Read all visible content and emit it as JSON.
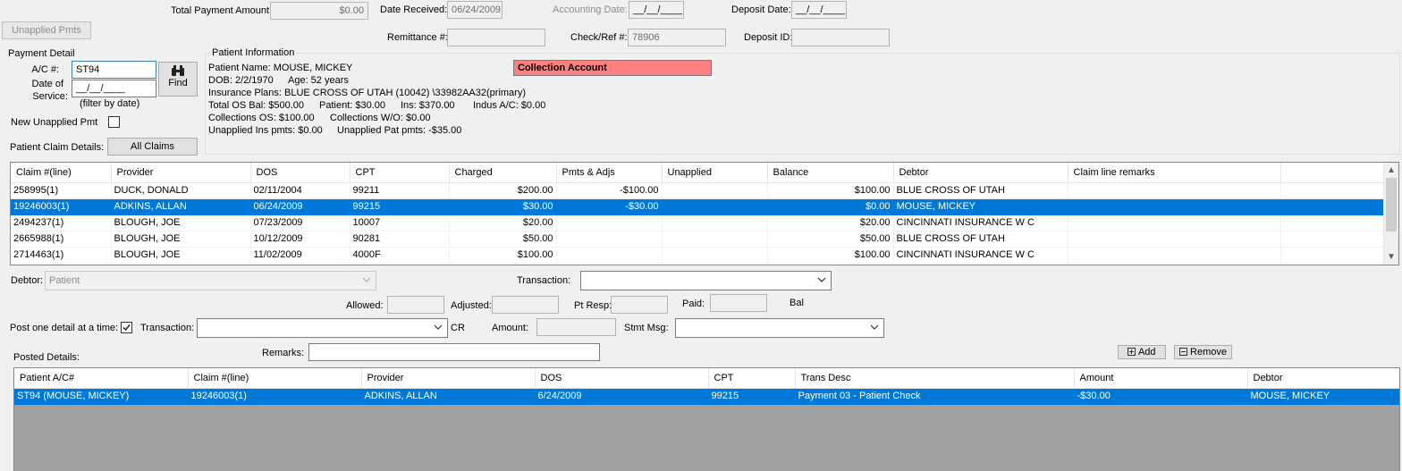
{
  "header": {
    "total_payment_label": "Total Payment Amount:",
    "total_payment_value": "$0.00",
    "date_received_label": "Date Received:",
    "date_received_value": "06/24/2009",
    "accounting_date_label": "Accounting Date:",
    "accounting_date_value": "__/__/____",
    "deposit_date_label": "Deposit Date:",
    "deposit_date_value": "__/__/____",
    "unapplied_pmts_button": "Unapplied Pmts",
    "remittance_label": "Remittance #:",
    "remittance_value": "",
    "check_ref_label": "Check/Ref #:",
    "check_ref_value": "78906",
    "deposit_id_label": "Deposit ID:",
    "deposit_id_value": ""
  },
  "payment_detail": {
    "title": "Payment Detail",
    "ac_label": "A/C #:",
    "ac_value": "ST94",
    "dos_label_1": "Date of",
    "dos_label_2": "Service:",
    "dos_value": "__/__/____",
    "filter_hint": "(filter by date)",
    "find_button": "Find",
    "new_unapplied_label": "New Unapplied Pmt",
    "claim_details_label": "Patient Claim Details:",
    "all_claims_button": "All Claims"
  },
  "patient_info": {
    "title": "Patient Information",
    "name": "Patient Name:  MOUSE, MICKEY",
    "dob": "DOB: 2/2/1970",
    "age": "Age: 52 years",
    "insurance": "Insurance Plans:  BLUE CROSS OF UTAH (10042) \\33982AA32(primary)",
    "total_os": "Total OS Bal:  $500.00",
    "patient_bal": "Patient:  $30.00",
    "ins_bal": "Ins:  $370.00",
    "indus": "Indus A/C:  $0.00",
    "collections_os": "Collections OS:  $100.00",
    "collections_wo": "Collections W/O:  $0.00",
    "unapplied_ins": "Unapplied Ins pmts:  $0.00",
    "unapplied_pat": "Unapplied Pat pmts:  -$35.00",
    "collection_badge": "Collection Account",
    "badge_color": "#ff8080"
  },
  "claims": {
    "columns": [
      "Claim #(line)",
      "Provider",
      "DOS",
      "CPT",
      "Charged",
      "Pmts & Adjs",
      "Unapplied",
      "Balance",
      "Debtor",
      "Claim line remarks",
      ""
    ],
    "rows": [
      [
        "258995(1)",
        "DUCK, DONALD",
        "02/11/2004",
        "99211",
        "$200.00",
        "-$100.00",
        "",
        "$100.00",
        "BLUE CROSS OF UTAH",
        "",
        ""
      ],
      [
        "19246003(1)",
        "ADKINS, ALLAN",
        "06/24/2009",
        "99215",
        "$30.00",
        "-$30.00",
        "",
        "$0.00",
        "MOUSE, MICKEY",
        "",
        ""
      ],
      [
        "2494237(1)",
        "BLOUGH, JOE",
        "07/23/2009",
        "10007",
        "$20.00",
        "",
        "",
        "$20.00",
        "CINCINNATI INSURANCE W C",
        "",
        ""
      ],
      [
        "2665988(1)",
        "BLOUGH, JOE",
        "10/12/2009",
        "90281",
        "$50.00",
        "",
        "",
        "$50.00",
        "BLUE CROSS OF UTAH",
        "",
        ""
      ],
      [
        "2714463(1)",
        "BLOUGH, JOE",
        "11/02/2009",
        "4000F",
        "$100.00",
        "",
        "",
        "$100.00",
        "CINCINNATI INSURANCE W C",
        "",
        ""
      ]
    ],
    "selected_index": 1
  },
  "entry": {
    "debtor_label": "Debtor:",
    "debtor_value": "Patient",
    "transaction_label": "Transaction:",
    "transaction_value": "",
    "allowed_label": "Allowed:",
    "adjusted_label": "Adjusted:",
    "pt_resp_label": "Pt Resp:",
    "paid_label": "Paid:",
    "bal_label": "Bal",
    "post_one_label": "Post one detail at a time:",
    "transaction2_label": "Transaction:",
    "transaction2_value": "",
    "cr_label": "CR",
    "amount_label": "Amount:",
    "stmt_msg_label": "Stmt Msg:",
    "stmt_msg_value": "",
    "remarks_label": "Remarks:",
    "remarks_value": "",
    "posted_details_label": "Posted Details:",
    "add_button": "Add",
    "remove_button": "Remove"
  },
  "posted": {
    "columns": [
      "Patient A/C#",
      "Claim #(line)",
      "Provider",
      "DOS",
      "CPT",
      "Trans Desc",
      "Amount",
      "Debtor"
    ],
    "rows": [
      [
        "ST94 (MOUSE, MICKEY)",
        "19246003(1)",
        "ADKINS, ALLAN",
        "6/24/2009",
        "99215",
        "Payment 03 - Patient Check",
        "-$30.00",
        "MOUSE, MICKEY"
      ]
    ],
    "selected_index": 0
  }
}
